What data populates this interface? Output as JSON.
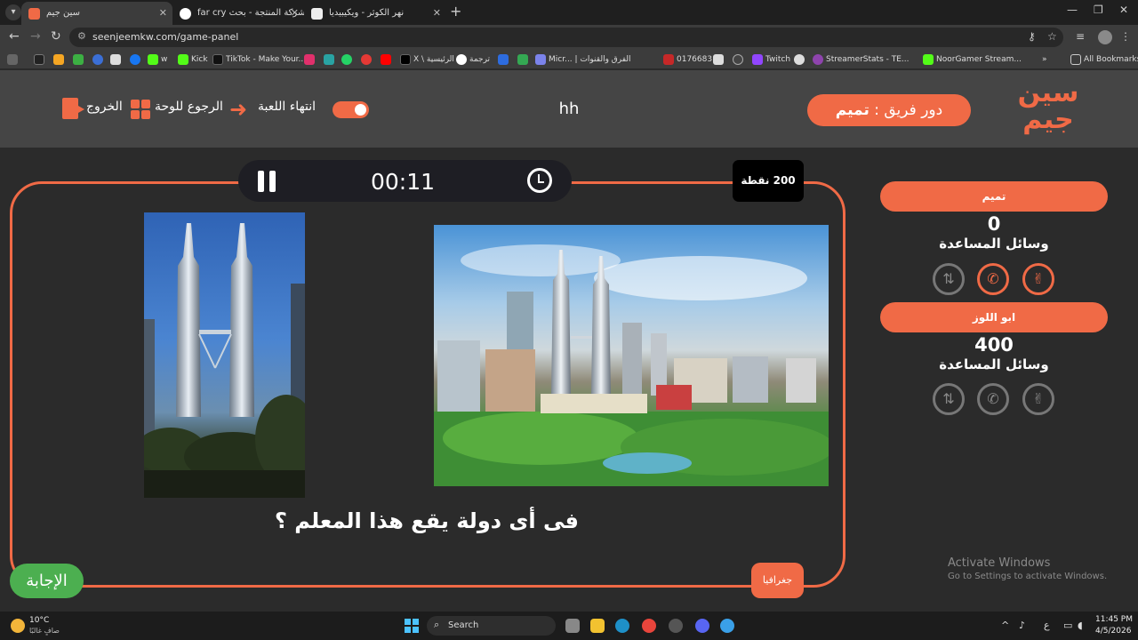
{
  "browser": {
    "tabs": [
      {
        "title": "سين جيم",
        "active": true
      },
      {
        "title": "far cry شركة المنتجة - بحث Goog",
        "active": false
      },
      {
        "title": "نهر الكوثر - ويكيبيديا",
        "active": false
      }
    ],
    "url": "seenjeemkw.com/game-panel",
    "bookmarks": [
      "Kick",
      "TikTok - Make Your...",
      "X \\ الرئيسية",
      "ترجمة",
      "Micr... | الفرق والقنوات",
      "0176683",
      "Twitch",
      "StreamerStats - TE...",
      "NoorGamer Stream..."
    ],
    "all_bookmarks": "All Bookmarks"
  },
  "header": {
    "logo_text": "سين جيم",
    "turn_label": "دور فريق :",
    "turn_team": "تميم",
    "game_name": "hh",
    "end_game": "انتهاء اللعبة",
    "back_to_board": "الرجوع للوحة",
    "exit": "الخروج"
  },
  "question": {
    "timer": "00:11",
    "points": "200 نقطة",
    "text": "فى أى دولة يقع هذا المعلم ؟",
    "category": "جغرافيا",
    "answer_button": "الإجابة"
  },
  "teams": [
    {
      "name": "تميم",
      "score": "0",
      "aids_label": "وسائل المساعدة"
    },
    {
      "name": "ابو اللوز",
      "score": "400",
      "aids_label": "وسائل المساعدة"
    }
  ],
  "watermark": {
    "title": "Activate Windows",
    "subtitle": "Go to Settings to activate Windows."
  },
  "taskbar": {
    "temp": "10°C",
    "weather": "صافٍ غالبًا",
    "search": "Search",
    "lang": "ع",
    "time": "11:45 PM",
    "date": "4/5/2026"
  }
}
